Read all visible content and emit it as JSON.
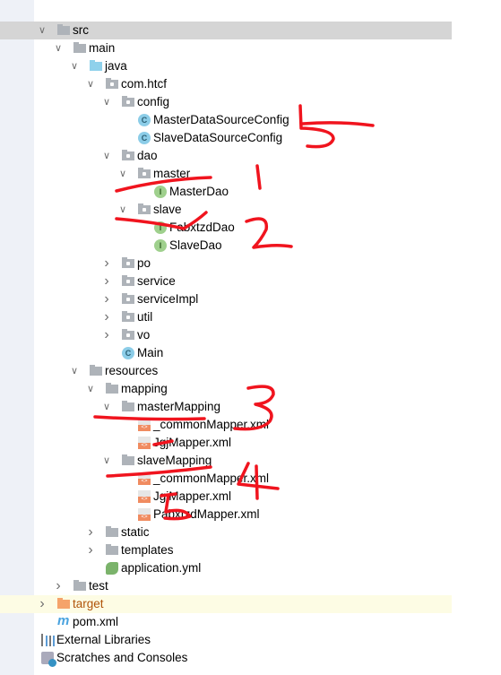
{
  "tree": [
    {
      "label": "src",
      "level": 0,
      "icon": "folder-icon",
      "expanded": true,
      "selected": true
    },
    {
      "label": "main",
      "level": 1,
      "icon": "folder-icon",
      "expanded": true
    },
    {
      "label": "java",
      "level": 2,
      "icon": "source-folder-icon",
      "expanded": true
    },
    {
      "label": "com.htcf",
      "level": 3,
      "icon": "package-icon",
      "expanded": true
    },
    {
      "label": "config",
      "level": 4,
      "icon": "package-icon",
      "expanded": true
    },
    {
      "label": "MasterDataSourceConfig",
      "level": 5,
      "icon": "class-icon"
    },
    {
      "label": "SlaveDataSourceConfig",
      "level": 5,
      "icon": "class-icon"
    },
    {
      "label": "dao",
      "level": 4,
      "icon": "package-icon",
      "expanded": true
    },
    {
      "label": "master",
      "level": 5,
      "icon": "package-icon",
      "expanded": true
    },
    {
      "label": "MasterDao",
      "level": 6,
      "icon": "interface-icon"
    },
    {
      "label": "slave",
      "level": 5,
      "icon": "package-icon",
      "expanded": true
    },
    {
      "label": "FabxtzdDao",
      "level": 6,
      "icon": "interface-icon"
    },
    {
      "label": "SlaveDao",
      "level": 6,
      "icon": "interface-icon"
    },
    {
      "label": "po",
      "level": 4,
      "icon": "package-icon",
      "expanded": false
    },
    {
      "label": "service",
      "level": 4,
      "icon": "package-icon",
      "expanded": false
    },
    {
      "label": "serviceImpl",
      "level": 4,
      "icon": "package-icon",
      "expanded": false
    },
    {
      "label": "util",
      "level": 4,
      "icon": "package-icon",
      "expanded": false
    },
    {
      "label": "vo",
      "level": 4,
      "icon": "package-icon",
      "expanded": false
    },
    {
      "label": "Main",
      "level": 4,
      "icon": "spring-boot-class-icon"
    },
    {
      "label": "resources",
      "level": 2,
      "icon": "resources-folder-icon",
      "expanded": true
    },
    {
      "label": "mapping",
      "level": 3,
      "icon": "folder-icon",
      "expanded": true
    },
    {
      "label": "masterMapping",
      "level": 4,
      "icon": "folder-icon",
      "expanded": true
    },
    {
      "label": "_commonMapper.xml",
      "level": 5,
      "icon": "xml-file-icon"
    },
    {
      "label": "JgjMapper.xml",
      "level": 5,
      "icon": "xml-file-icon"
    },
    {
      "label": "slaveMapping",
      "level": 4,
      "icon": "folder-icon",
      "expanded": true
    },
    {
      "label": "_commonMapper.xml",
      "level": 5,
      "icon": "xml-file-icon"
    },
    {
      "label": "JgjMapper.xml",
      "level": 5,
      "icon": "xml-file-icon"
    },
    {
      "label": "PabxtzdMapper.xml",
      "level": 5,
      "icon": "xml-file-icon"
    },
    {
      "label": "static",
      "level": 3,
      "icon": "folder-icon",
      "expanded": false
    },
    {
      "label": "templates",
      "level": 3,
      "icon": "folder-icon",
      "expanded": false
    },
    {
      "label": "application.yml",
      "level": 3,
      "icon": "spring-yml-icon"
    },
    {
      "label": "test",
      "level": 1,
      "icon": "folder-icon",
      "expanded": false
    },
    {
      "label": "target",
      "level": 0,
      "icon": "excluded-folder-icon",
      "expanded": false,
      "excluded": true
    },
    {
      "label": "pom.xml",
      "level": 0,
      "icon": "maven-icon"
    },
    {
      "label": "External Libraries",
      "level": -1,
      "icon": "libraries-icon"
    },
    {
      "label": "Scratches and Consoles",
      "level": -1,
      "icon": "scratches-icon"
    }
  ],
  "annotations": [
    "1",
    "2",
    "3",
    "4",
    "5",
    "5"
  ],
  "colors": {
    "annotation": "#f0141e",
    "selected_row": "#d5d5d5",
    "excluded_row": "#fdfce4",
    "excluded_text": "#b0540a"
  }
}
